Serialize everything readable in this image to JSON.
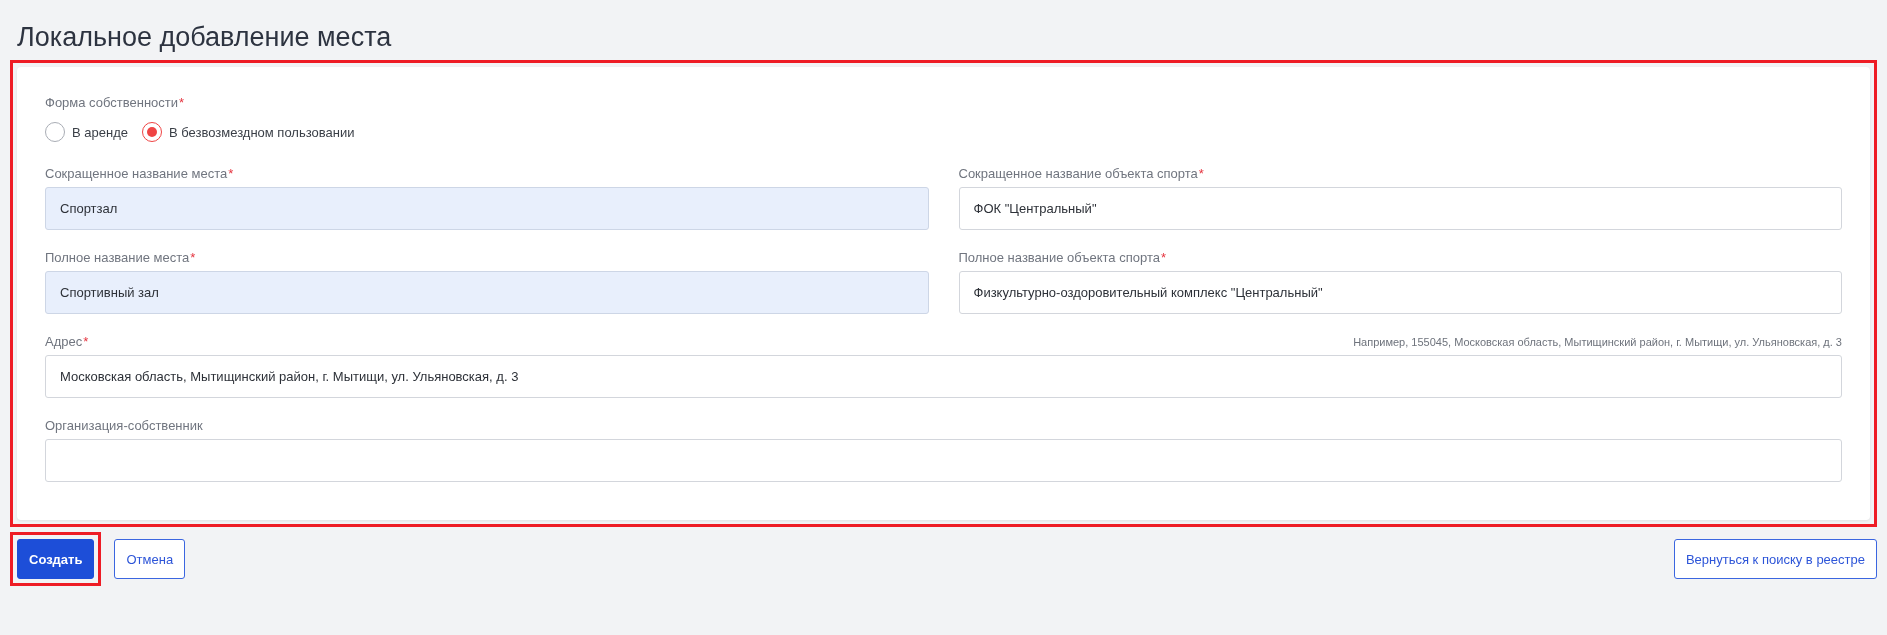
{
  "title": "Локальное добавление места",
  "form": {
    "highlighted": true,
    "ownership": {
      "label": "Форма собственности",
      "required_mark": "*",
      "options": [
        {
          "label": "В аренде",
          "selected": false
        },
        {
          "label": "В безвозмездном пользовании",
          "selected": true
        }
      ]
    },
    "rows": [
      [
        {
          "label": "Сокращенное название места",
          "required_mark": "*",
          "value": "Спортзал",
          "autofilled": true
        },
        {
          "label": "Сокращенное название объекта спорта",
          "required_mark": "*",
          "value": "ФОК \"Центральный\"",
          "autofilled": false
        }
      ],
      [
        {
          "label": "Полное название места",
          "required_mark": "*",
          "value": "Спортивный зал",
          "autofilled": true
        },
        {
          "label": "Полное название объекта спорта",
          "required_mark": "*",
          "value": "Физкультурно-оздоровительный комплекс \"Центральный\"",
          "autofilled": false
        }
      ],
      [
        {
          "label": "Адрес",
          "required_mark": "*",
          "hint": "Например, 155045, Московская область, Мытищинский район, г. Мытищи, ул. Ульяновская, д. 3",
          "value": "Московская область, Мытищинский район, г. Мытищи, ул. Ульяновская, д. 3",
          "autofilled": false
        }
      ],
      [
        {
          "label": "Организация-собственник",
          "autofilled": false
        }
      ]
    ]
  },
  "actions": [
    {
      "label": "Создать",
      "kind": "primary",
      "highlighted": true
    },
    {
      "label": "Отмена",
      "kind": "secondary",
      "highlighted": false
    }
  ],
  "back_button": {
    "label": "Вернуться к поиску в реестре"
  }
}
